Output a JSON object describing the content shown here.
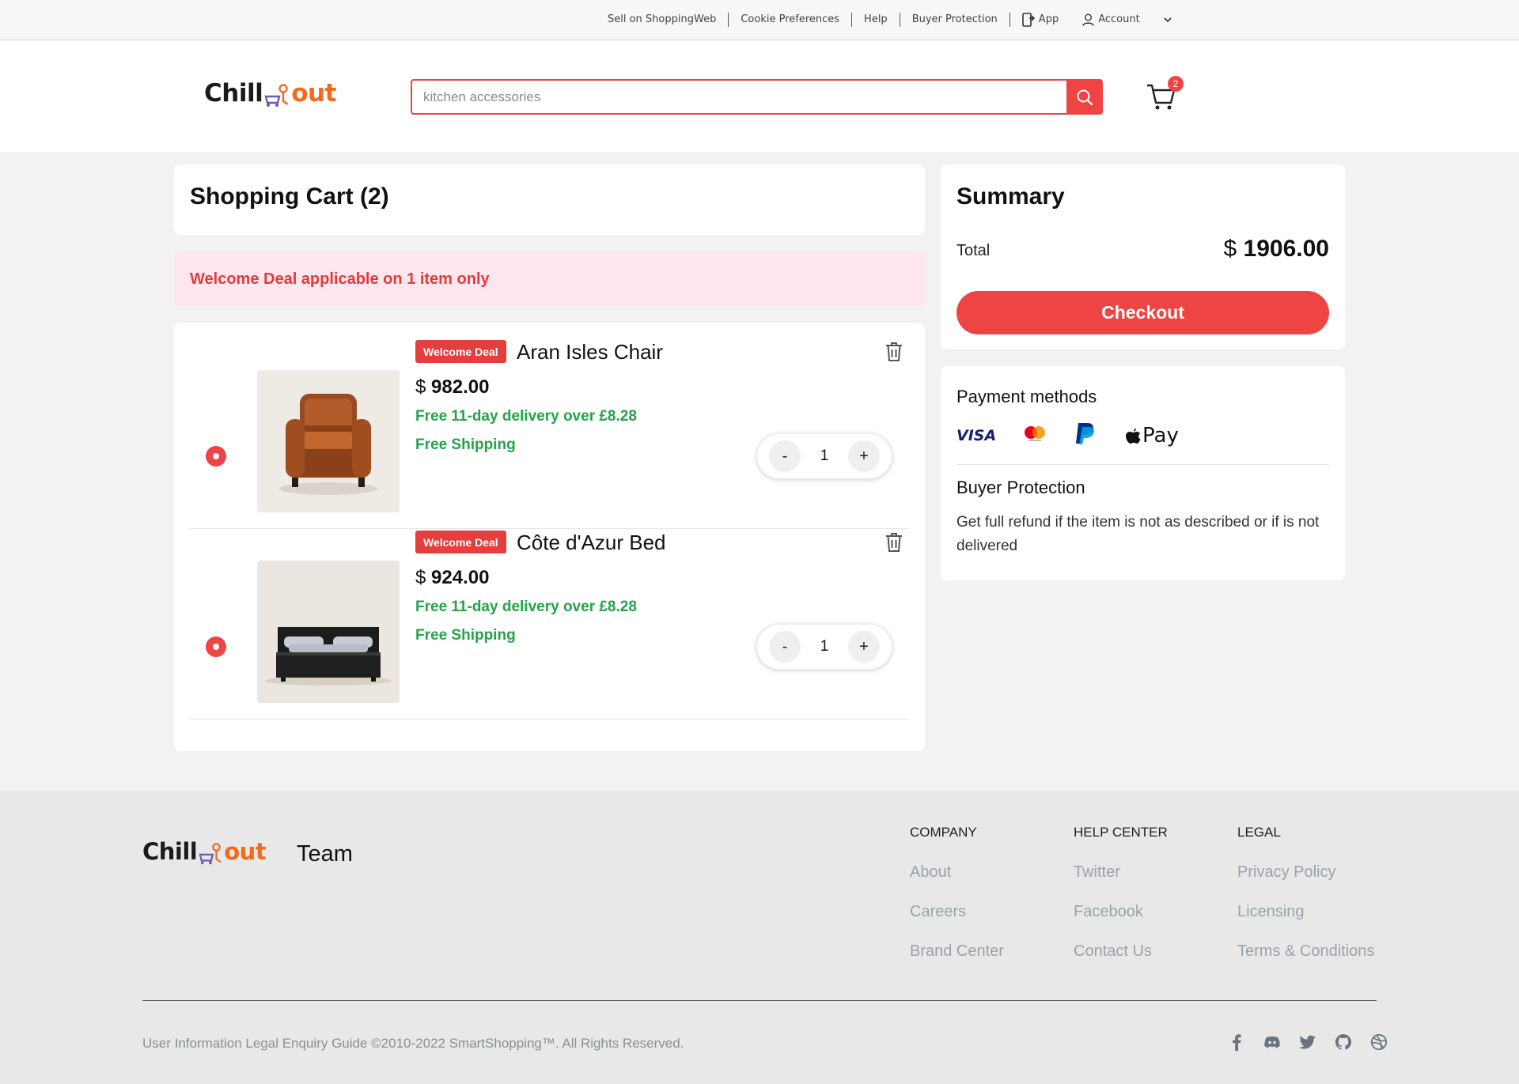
{
  "topbar": {
    "links": [
      "Sell on ShoppingWeb",
      "Cookie Preferences",
      "Help",
      "Buyer Protection",
      "App",
      "Account"
    ]
  },
  "brand": {
    "logo_left": "Chill",
    "logo_right": "out",
    "team_label": "Team"
  },
  "search": {
    "placeholder": "kitchen accessories"
  },
  "cart": {
    "badge_count": "2"
  },
  "cart_page": {
    "title": "Shopping Cart (2)",
    "deal_banner": "Welcome Deal applicable on 1 item only",
    "items": [
      {
        "tag": "Welcome Deal",
        "name": "Aran Isles Chair",
        "currency": "$",
        "price": "982.00",
        "delivery": "Free 11-day delivery over £8.28",
        "shipping": "Free Shipping",
        "qty": "1"
      },
      {
        "tag": "Welcome Deal",
        "name": "Côte d'Azur Bed",
        "currency": "$",
        "price": "924.00",
        "delivery": "Free 11-day delivery over £8.28",
        "shipping": "Free Shipping",
        "qty": "1"
      }
    ],
    "stepper": {
      "minus": "-",
      "plus": "+"
    }
  },
  "summary": {
    "title": "Summary",
    "total_label": "Total",
    "total_currency": "$",
    "total_amount": "1906.00",
    "checkout_label": "Checkout"
  },
  "payment": {
    "title": "Payment methods",
    "methods": [
      "visa-icon",
      "mastercard-icon",
      "paypal-icon",
      "apple-pay-icon"
    ],
    "visa_text": "VISA",
    "apple_pay_text": "Pay",
    "buyer_protection_title": "Buyer Protection",
    "buyer_protection_text": "Get full refund if the item is not as described or if is not delivered"
  },
  "footer": {
    "columns": [
      {
        "heading": "COMPANY",
        "links": [
          "About",
          "Careers",
          "Brand Center"
        ]
      },
      {
        "heading": "HELP CENTER",
        "links": [
          "Twitter",
          "Facebook",
          "Contact Us"
        ]
      },
      {
        "heading": "LEGAL",
        "links": [
          "Privacy Policy",
          "Licensing",
          "Terms & Conditions"
        ]
      }
    ],
    "copyright": "User Information Legal Enquiry Guide ©2010-2022 SmartShopping™. All Rights Reserved.",
    "socials": [
      "facebook-icon",
      "discord-icon",
      "twitter-icon",
      "github-icon",
      "dribbble-icon"
    ]
  },
  "colors": {
    "accent": "#ef4444",
    "green": "#22a34a",
    "logo_orange": "#f26b1d",
    "banner_bg": "#fde6ee"
  }
}
